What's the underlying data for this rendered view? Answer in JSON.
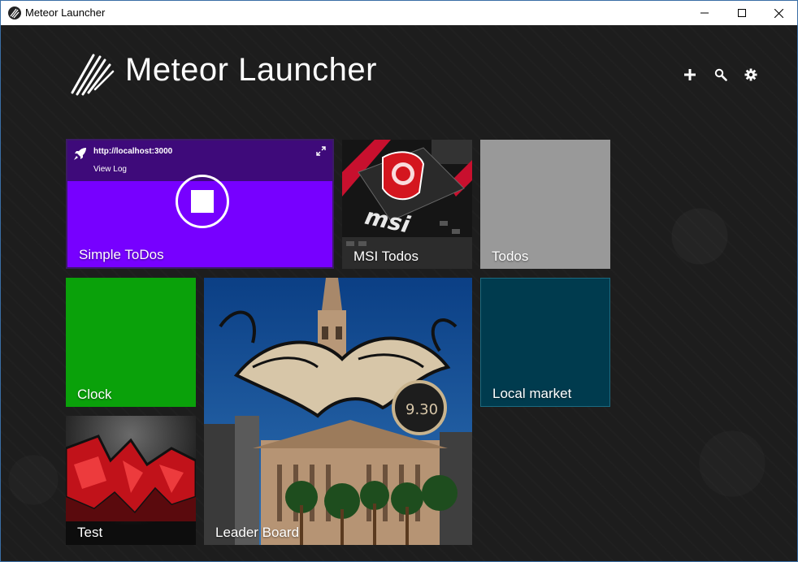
{
  "window": {
    "title": "Meteor Launcher",
    "controls": [
      "minimize",
      "maximize",
      "close"
    ]
  },
  "header": {
    "brand": "Meteor Launcher",
    "actions": [
      {
        "icon": "plus-icon"
      },
      {
        "icon": "search-icon"
      },
      {
        "icon": "gear-icon"
      }
    ]
  },
  "tiles": {
    "simple_todos": {
      "label": "Simple ToDos",
      "url": "http://localhost:3000",
      "view_log": "View Log",
      "color": "#7700ff",
      "header_color": "#3e0a7a",
      "running": true
    },
    "msi_todos": {
      "label": "MSI Todos"
    },
    "todos": {
      "label": "Todos",
      "color": "#999999"
    },
    "clock": {
      "label": "Clock",
      "color": "#0aa10a"
    },
    "leader_board": {
      "label": "Leader Board"
    },
    "local_market": {
      "label": "Local market",
      "color": "#003b4e"
    },
    "test": {
      "label": "Test"
    }
  }
}
